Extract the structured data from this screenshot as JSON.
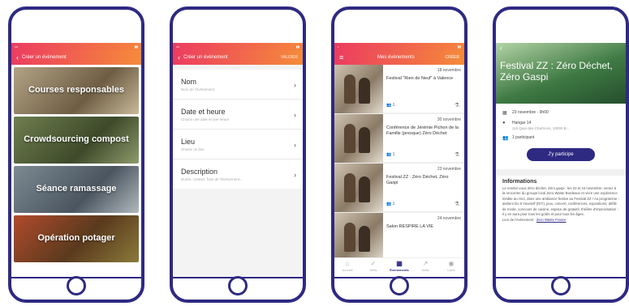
{
  "screens": {
    "create": {
      "header_title": "Créer un évènement",
      "categories": [
        {
          "label": "Courses responsables"
        },
        {
          "label": "Crowdsourcing compost"
        },
        {
          "label": "Séance ramassage"
        },
        {
          "label": "Opération potager"
        }
      ]
    },
    "form": {
      "header_title": "Créer un évènement",
      "validate_label": "VALIDER",
      "fields": [
        {
          "label": "Nom",
          "placeholder": "Nom de l'évènement"
        },
        {
          "label": "Date et heure",
          "placeholder": "Choisir une date et une heure"
        },
        {
          "label": "Lieu",
          "placeholder": "Choisir un lieu"
        },
        {
          "label": "Description",
          "placeholder": "Durée, contact, frais de l'évènement..."
        }
      ]
    },
    "events": {
      "header_title": "Mes évènements",
      "create_label": "CRÉER",
      "events": [
        {
          "date": "18 novembre",
          "title": "Festival \"Rien de Neuf\" à Valence",
          "participants": "1"
        },
        {
          "date": "30 novembre",
          "title": "Conférence de Jérémie Pichon de la Famille (presque) Zéro Déchet",
          "participants": "1"
        },
        {
          "date": "23 novembre",
          "title": "Festival ZZ : Zéro Déchet, Zéro Gaspi",
          "participants": "1"
        },
        {
          "date": "24 novembre",
          "title": "Salon RESPIRE LA VIE",
          "participants": ""
        }
      ],
      "tabs": [
        {
          "label": "Accueil",
          "icon": "home-icon"
        },
        {
          "label": "Défis",
          "icon": "check-icon"
        },
        {
          "label": "Évènements",
          "icon": "calendar-icon"
        },
        {
          "label": "Stats",
          "icon": "chart-icon"
        },
        {
          "label": "Carte",
          "icon": "map-pin-icon"
        }
      ]
    },
    "detail": {
      "title": "Festival ZZ : Zéro Déchet, Zéro Gaspi",
      "date": "23 novembre - 9h00",
      "place_name": "Hangar 14",
      "place_address": "115 Quai des Chartrons, 33000 B...",
      "participants": "1 participant",
      "cta_label": "J'y participe",
      "info_heading": "Informations",
      "info_text": "Le rendez-vous Zéro déchet, Zéro gaspi : les 23 et 24 novembre, venez à la rencontre du groupe local Zero Waste Bordeaux et vivre une expérience inédite au H14, dans une ambiance festive au Festival ZZ ! Au programme : ateliers Do It Yourself (DIY), jeux, concert, conférences, expositions, défilé de mode, concours de cuisine, espace de gratuité, théâtre d'improvisation : il y en aura pour tous les goûts et pour tous les âges.",
      "link_prefix": "Lien de l'évènement : ",
      "link_text": "Zero Waste France"
    }
  }
}
